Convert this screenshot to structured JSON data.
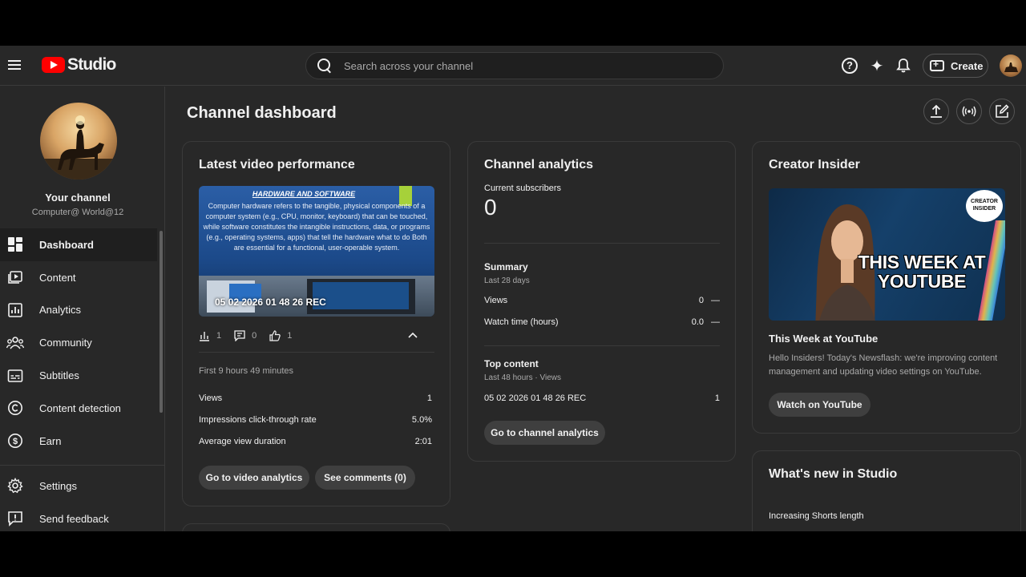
{
  "app": {
    "logo_text": "Studio"
  },
  "search": {
    "placeholder": "Search across your channel"
  },
  "header": {
    "create_label": "Create"
  },
  "sidebar": {
    "channel_name": "Your channel",
    "channel_handle": "Computer@ World@12",
    "items": [
      {
        "label": "Dashboard",
        "icon": "dashboard-icon",
        "active": true
      },
      {
        "label": "Content",
        "icon": "content-icon"
      },
      {
        "label": "Analytics",
        "icon": "analytics-icon"
      },
      {
        "label": "Community",
        "icon": "community-icon"
      },
      {
        "label": "Subtitles",
        "icon": "subtitles-icon"
      },
      {
        "label": "Content detection",
        "icon": "content-detection-icon"
      },
      {
        "label": "Earn",
        "icon": "earn-icon"
      }
    ],
    "bottom_items": [
      {
        "label": "Settings",
        "icon": "gear-icon"
      },
      {
        "label": "Send feedback",
        "icon": "feedback-icon"
      }
    ]
  },
  "main": {
    "title": "Channel dashboard"
  },
  "latest_video": {
    "title": "Latest video performance",
    "thumbnail": {
      "heading": "HARDWARE AND SOFTWARE",
      "text": "Computer hardware refers to the tangible, physical components of a computer system (e.g., CPU, monitor, keyboard) that can be touched, while software constitutes the intangible instructions, data, or programs (e.g., operating systems, apps) that tell the hardware what to do Both are essential for a functional, user-operable system.",
      "overlay": "05 02 2026 01 48 26 REC"
    },
    "stats": {
      "views": "1",
      "comments": "0",
      "likes": "1"
    },
    "period": "First 9 hours 49 minutes",
    "metrics": [
      {
        "label": "Views",
        "value": "1"
      },
      {
        "label": "Impressions click-through rate",
        "value": "5.0%"
      },
      {
        "label": "Average view duration",
        "value": "2:01"
      }
    ],
    "buttons": {
      "analytics": "Go to video analytics",
      "comments": "See comments (0)"
    }
  },
  "channel_analytics": {
    "title": "Channel analytics",
    "subscribers_label": "Current subscribers",
    "subscribers_value": "0",
    "summary_title": "Summary",
    "summary_period": "Last 28 days",
    "summary_rows": [
      {
        "label": "Views",
        "value": "0",
        "delta": "—"
      },
      {
        "label": "Watch time (hours)",
        "value": "0.0",
        "delta": "—"
      }
    ],
    "top_title": "Top content",
    "top_period": "Last 48 hours · Views",
    "top_items": [
      {
        "label": "05 02 2026 01 48 26 REC",
        "value": "1"
      }
    ],
    "button": "Go to channel analytics"
  },
  "creator_insider": {
    "title": "Creator Insider",
    "badge": "CREATOR INSIDER",
    "headline": "THIS WEEK AT YOUTUBE",
    "video_title": "This Week at YouTube",
    "description": "Hello Insiders! Today's Newsflash: we're improving content management and updating video settings on YouTube.",
    "button": "Watch on YouTube"
  },
  "whats_new": {
    "title": "What's new in Studio",
    "items": [
      "Increasing Shorts length"
    ]
  },
  "colors": {
    "background": "#282828",
    "accent": "#ff0000",
    "button": "#3f3f3f"
  }
}
